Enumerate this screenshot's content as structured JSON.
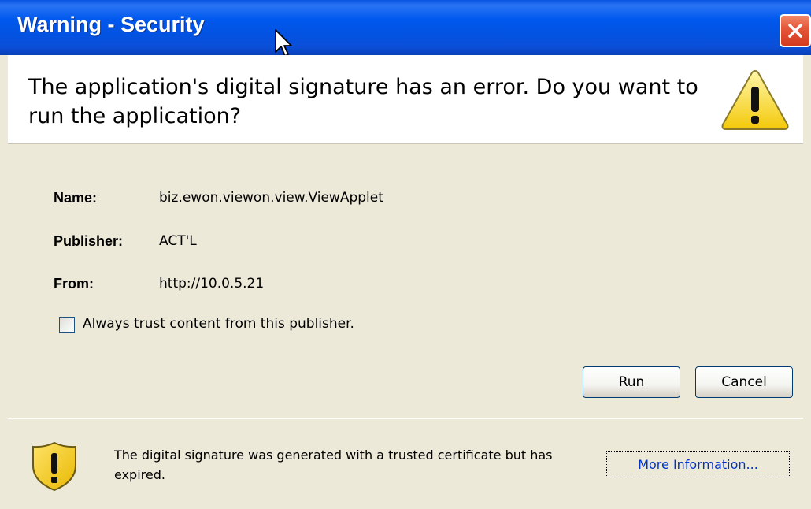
{
  "window": {
    "title": "Warning - Security"
  },
  "header": {
    "message": "The application's digital signature has an error.  Do you want to run the application?",
    "icon": "warning-triangle-icon"
  },
  "details": {
    "name_label": "Name:",
    "name_value": "biz.ewon.viewon.view.ViewApplet",
    "publisher_label": "Publisher:",
    "publisher_value": "ACT'L",
    "from_label": "From:",
    "from_value": "http://10.0.5.21"
  },
  "trust_checkbox": {
    "label": "Always trust content from this publisher.",
    "checked": false
  },
  "buttons": {
    "run": "Run",
    "cancel": "Cancel"
  },
  "footer": {
    "icon": "shield-warning-icon",
    "message": "The digital signature was generated with a trusted certificate but has expired.",
    "more_info": "More Information..."
  },
  "colors": {
    "titlebar": "#0058ee",
    "body": "#ece9d8",
    "close": "#d23a1e",
    "link": "#0033cc"
  }
}
